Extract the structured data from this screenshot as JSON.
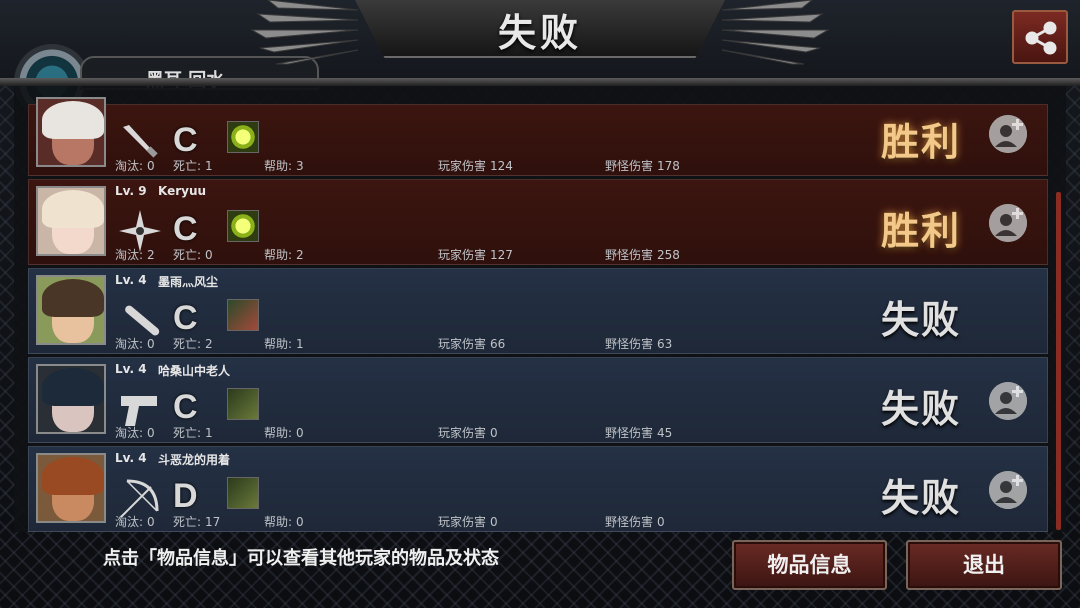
{
  "header": {
    "title": "失败",
    "hidden_tab_label": "黑耳 回水"
  },
  "stat_labels": {
    "eliminations": "淘汰:",
    "deaths": "死亡:",
    "assists": "帮助:",
    "player_damage": "玩家伤害",
    "monster_damage": "野怪伤害"
  },
  "players": [
    {
      "level": "",
      "name": "",
      "weapon": "knife-icon",
      "grade": "C",
      "item": "gem-item-icon",
      "eliminations": "0",
      "deaths": "1",
      "assists": "3",
      "player_damage": "124",
      "monster_damage": "178",
      "result": "胜利",
      "add_friend": true
    },
    {
      "level": "Lv. 9",
      "name": "Keryuu",
      "weapon": "shuriken-icon",
      "grade": "C",
      "item": "gem-item-icon",
      "eliminations": "2",
      "deaths": "0",
      "assists": "2",
      "player_damage": "127",
      "monster_damage": "258",
      "result": "胜利",
      "add_friend": true
    },
    {
      "level": "Lv. 4",
      "name": "墨雨灬风尘",
      "weapon": "baton-icon",
      "grade": "C",
      "item": "character-item-icon",
      "eliminations": "0",
      "deaths": "2",
      "assists": "1",
      "player_damage": "66",
      "monster_damage": "63",
      "result": "失败",
      "add_friend": false
    },
    {
      "level": "Lv. 4",
      "name": "哈桑山中老人",
      "weapon": "pistol-icon",
      "grade": "C",
      "item": "armor-item-icon",
      "eliminations": "0",
      "deaths": "1",
      "assists": "0",
      "player_damage": "0",
      "monster_damage": "45",
      "result": "失败",
      "add_friend": true
    },
    {
      "level": "Lv. 4",
      "name": "斗恶龙的用着",
      "weapon": "bow-icon",
      "grade": "D",
      "item": "armor-item-icon",
      "eliminations": "0",
      "deaths": "17",
      "assists": "0",
      "player_damage": "0",
      "monster_damage": "0",
      "result": "失败",
      "add_friend": true
    }
  ],
  "footer": {
    "hint": "点击「物品信息」可以查看其他玩家的物品及状态",
    "items_button": "物品信息",
    "exit_button": "退出"
  },
  "colors": {
    "win_row": "#3c1510",
    "lose_row": "#243044",
    "win_text": "#f2c98a",
    "button": "#6a2a24"
  }
}
